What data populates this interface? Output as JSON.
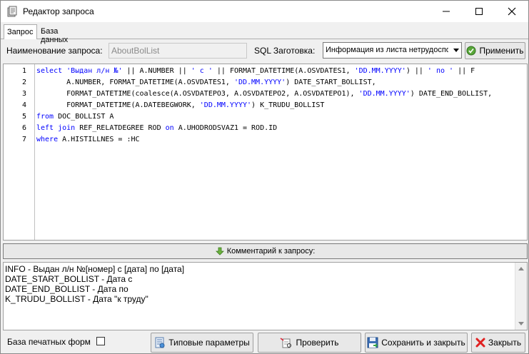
{
  "window": {
    "title": "Редактор запроса"
  },
  "tabs": [
    {
      "label": "Запрос",
      "active": true
    },
    {
      "label": "База данных",
      "active": false
    }
  ],
  "query": {
    "name_label": "Наименование запроса:",
    "name_value": "AboutBolList",
    "sql_template_label": "SQL Заготовка:",
    "sql_template_selected": "Информация из листа нетрудоспо",
    "apply_label": "Применить"
  },
  "editor": {
    "line_numbers": [
      "1",
      "2",
      "3",
      "4",
      "5",
      "6",
      "7"
    ]
  },
  "comment": {
    "bar_label": "Комментарий к запросу:",
    "lines": [
      "INFO - Выдан л/н №[номер] с [дата] по [дата]",
      "DATE_START_BOLLIST - Дата с",
      "DATE_END_BOLLIST - Дата по",
      "K_TRUDU_BOLLIST - Дата \"к труду\""
    ]
  },
  "footer": {
    "print_forms_label": "База печатных форм",
    "params_label": "Типовые параметры",
    "check_label": "Проверить",
    "save_close_label": "Сохранить и закрыть",
    "close_label": "Закрыть"
  },
  "colors": {
    "keyword": "#0000ff",
    "string": "#0000ff",
    "close_x": "#e02020"
  }
}
